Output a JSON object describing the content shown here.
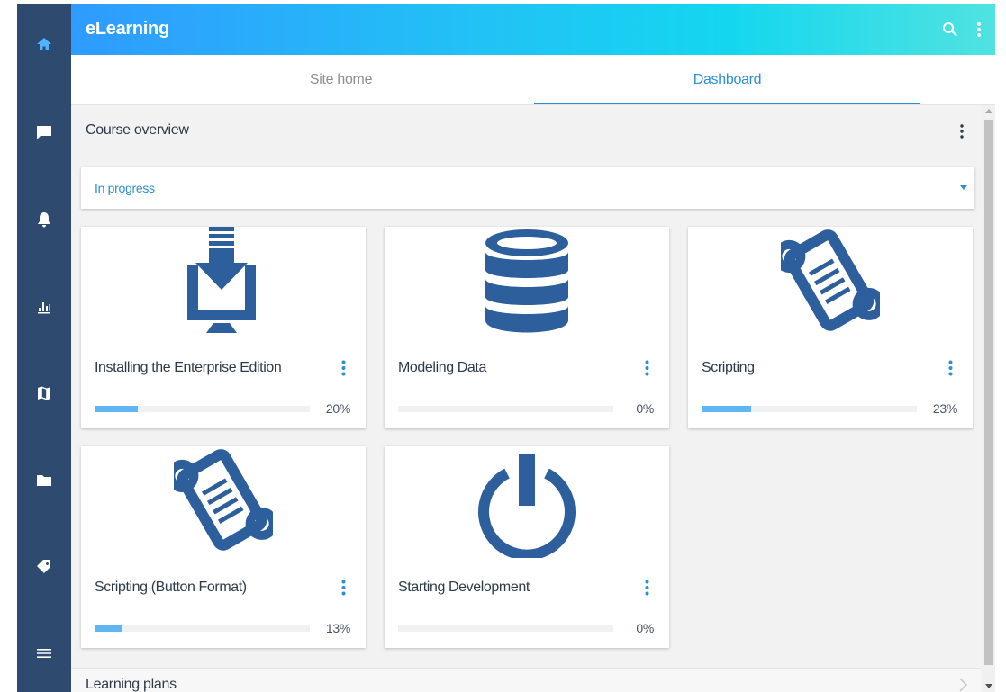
{
  "colors": {
    "sidebar": "#2e4a6e",
    "accent": "#2b8fd6",
    "icon_blue": "#2d5f9c",
    "progress": "#5fb6f2",
    "appbar_gradient": [
      "#2f9bff",
      "#14d6ef",
      "#52e3e0"
    ]
  },
  "app": {
    "title": "eLearning"
  },
  "appbar": {
    "search_icon": "search-icon",
    "menu_icon": "more-vert-icon"
  },
  "sidebar": {
    "items": [
      {
        "icon": "home-icon",
        "active": true
      },
      {
        "icon": "chat-icon"
      },
      {
        "icon": "bell-icon"
      },
      {
        "icon": "bar-chart-icon"
      },
      {
        "icon": "map-icon"
      },
      {
        "icon": "folder-icon"
      },
      {
        "icon": "tag-icon"
      },
      {
        "icon": "hamburger-menu-icon"
      }
    ]
  },
  "tabs": [
    {
      "label": "Site home"
    },
    {
      "label": "Dashboard",
      "active": true
    }
  ],
  "course_overview": {
    "title": "Course overview",
    "filter": {
      "selected": "In progress"
    },
    "courses": [
      {
        "name": "Installing the Enterprise Edition",
        "progress": 20,
        "progress_label": "20%",
        "icon": "download-monitor-icon"
      },
      {
        "name": "Modeling Data",
        "progress": 0,
        "progress_label": "0%",
        "icon": "database-icon"
      },
      {
        "name": "Scripting",
        "progress": 23,
        "progress_label": "23%",
        "icon": "script-scroll-icon"
      },
      {
        "name": "Scripting (Button Format)",
        "progress": 13,
        "progress_label": "13%",
        "icon": "script-scroll-icon"
      },
      {
        "name": "Starting Development",
        "progress": 0,
        "progress_label": "0%",
        "icon": "power-icon"
      }
    ]
  },
  "learning_plans": {
    "title": "Learning plans"
  }
}
